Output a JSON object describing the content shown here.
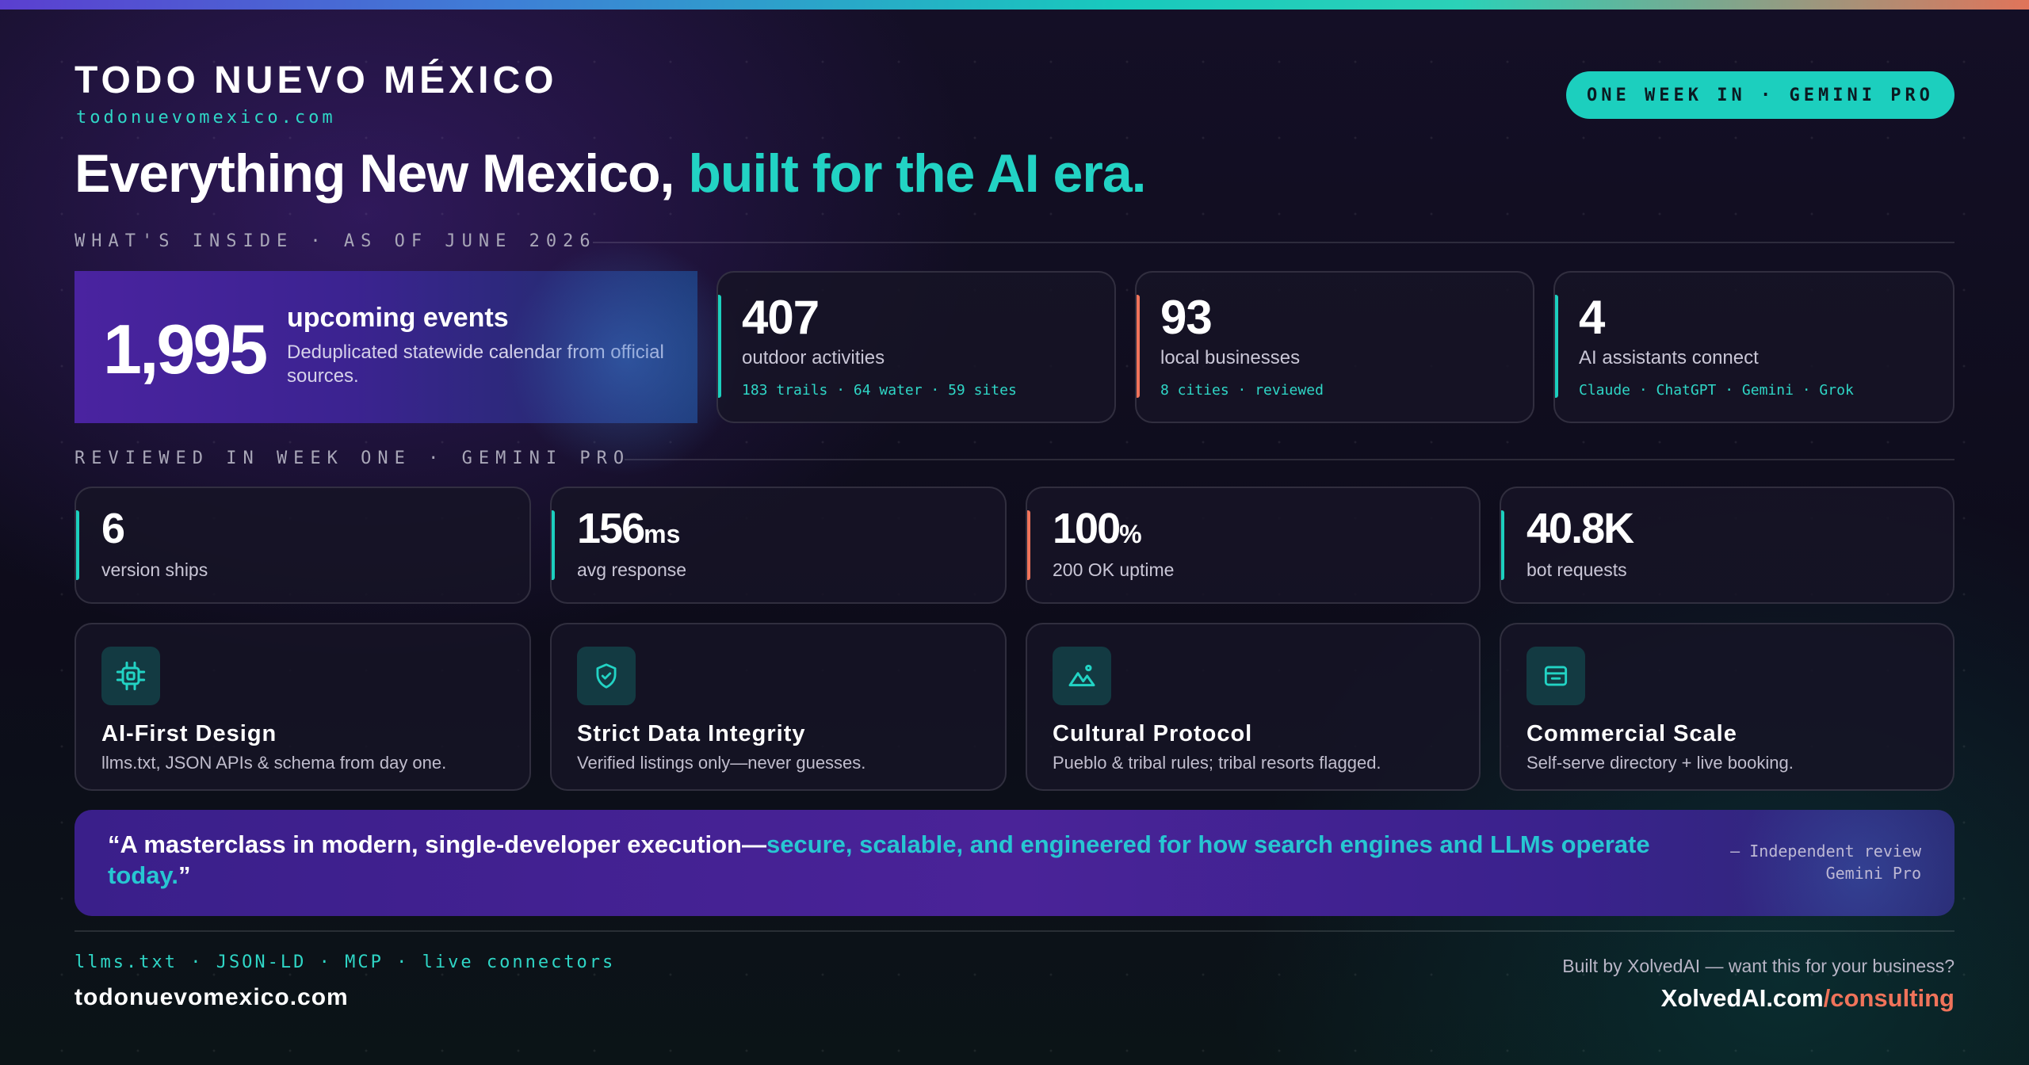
{
  "brand": {
    "name": "TODO NUEVO MÉXICO",
    "url": "todonuevomexico.com"
  },
  "badge": "ONE WEEK IN · GEMINI PRO",
  "headline": {
    "main": "Everything New Mexico,",
    "accent": "built for the AI era."
  },
  "sections": {
    "inside": "WHAT'S INSIDE · AS OF JUNE 2026",
    "reviewed": "REVIEWED IN WEEK ONE · GEMINI PRO"
  },
  "hero": {
    "number": "1,995",
    "title": "upcoming events",
    "description": "Deduplicated statewide calendar from official sources."
  },
  "stats": [
    {
      "number": "407",
      "label": "outdoor activities",
      "sub": "183 trails · 64 water · 59 sites",
      "accent": "#1ccfbe"
    },
    {
      "number": "93",
      "label": "local businesses",
      "sub": "8 cities · reviewed",
      "accent": "#f0735a"
    },
    {
      "number": "4",
      "label": "AI assistants connect",
      "sub": "Claude · ChatGPT · Gemini · Grok",
      "accent": "#1ccfbe"
    }
  ],
  "metrics": [
    {
      "number": "6",
      "unit": "",
      "label": "version ships",
      "accent": "#1ccfbe"
    },
    {
      "number": "156",
      "unit": "ms",
      "label": "avg response",
      "accent": "#1ccfbe"
    },
    {
      "number": "100",
      "unit": "%",
      "label": "200 OK uptime",
      "accent": "#f0735a"
    },
    {
      "number": "40.8K",
      "unit": "",
      "label": "bot requests",
      "accent": "#1ccfbe"
    }
  ],
  "features": [
    {
      "icon": "chip-icon",
      "title": "AI-First Design",
      "desc": "llms.txt, JSON APIs & schema from day one."
    },
    {
      "icon": "shield-check-icon",
      "title": "Strict Data Integrity",
      "desc": "Verified listings only—never guesses."
    },
    {
      "icon": "mountain-icon",
      "title": "Cultural Protocol",
      "desc": "Pueblo & tribal rules; tribal resorts flagged."
    },
    {
      "icon": "storefront-icon",
      "title": "Commercial Scale",
      "desc": "Self-serve directory + live booking."
    }
  ],
  "quote": {
    "text": "“A masterclass in modern, single-developer execution—",
    "accent": "secure, scalable, and engineered for how search engines and LLMs operate today.",
    "close": "”",
    "attribution_line1": "— Independent review",
    "attribution_line2": "Gemini Pro"
  },
  "footer": {
    "tags": "llms.txt · JSON-LD · MCP · live connectors",
    "site": "todonuevomexico.com",
    "built_by": "Built by XolvedAI — want this for your business?",
    "cta_main": "XolvedAI.com",
    "cta_accent": "/consulting"
  },
  "colors": {
    "teal": "#1ccfbe",
    "coral": "#f0735a",
    "purple": "#4a23a0",
    "background": "#0e0b1c"
  }
}
